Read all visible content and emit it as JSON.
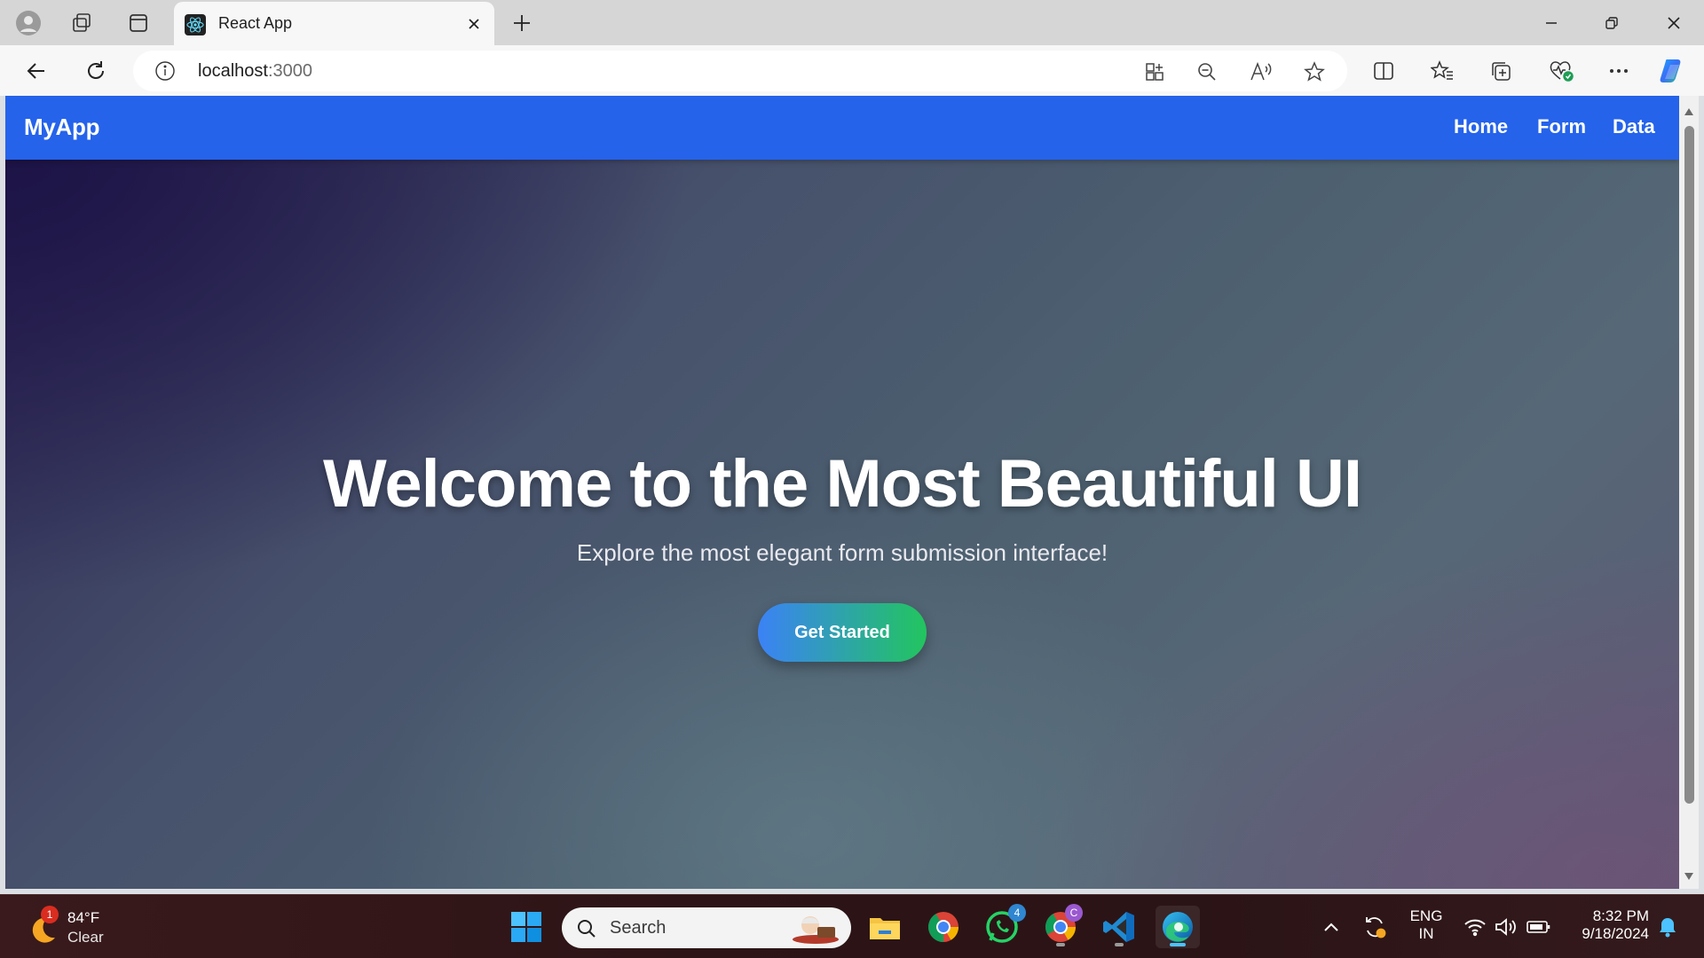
{
  "browser": {
    "tab_title": "React App",
    "url_host": "localhost",
    "url_port": ":3000"
  },
  "page": {
    "brand": "MyApp",
    "nav": [
      "Home",
      "Form",
      "Data"
    ],
    "hero_title": "Welcome to the Most Beautiful UI",
    "hero_subtitle": "Explore the most elegant form submission interface!",
    "cta_label": "Get Started",
    "colors": {
      "navbar": "#2563eb",
      "cta_start": "#3b82f6",
      "cta_end": "#22c55e"
    }
  },
  "taskbar": {
    "weather_temp": "84°F",
    "weather_condition": "Clear",
    "weather_badge": "1",
    "search_placeholder": "Search",
    "whatsapp_badge": "4",
    "chrome_profile_badge": "C",
    "lang_line1": "ENG",
    "lang_line2": "IN",
    "time": "8:32 PM",
    "date": "9/18/2024"
  }
}
